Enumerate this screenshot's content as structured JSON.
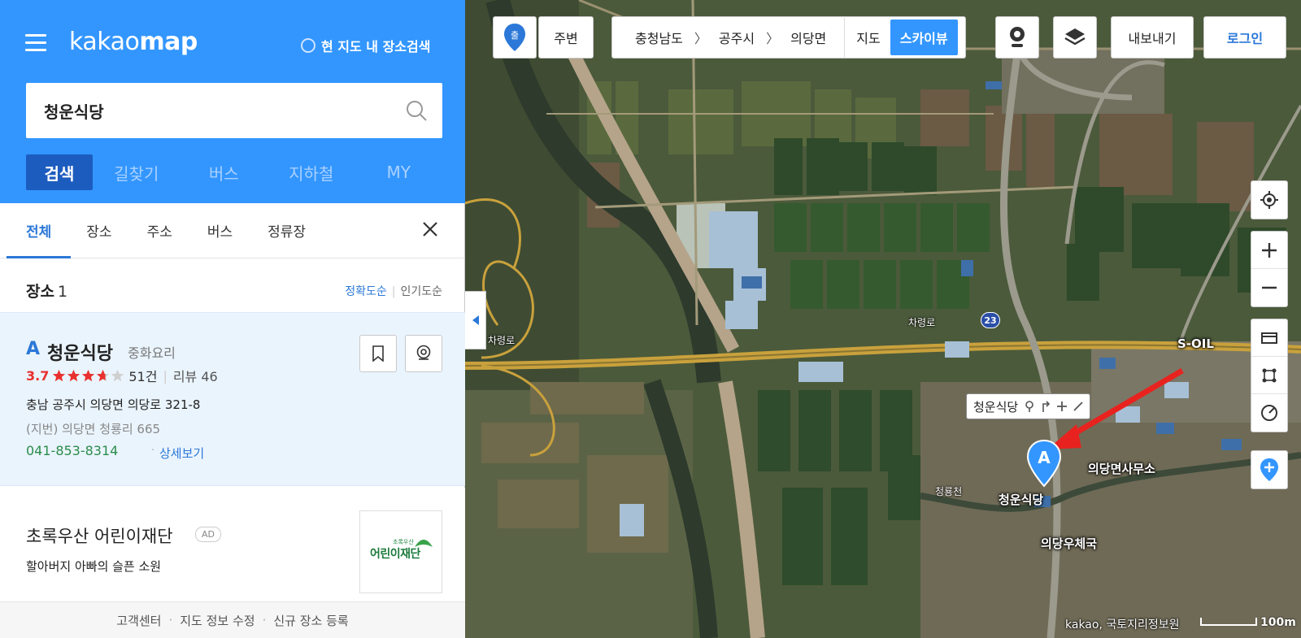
{
  "header": {
    "logo_left": "kakao",
    "logo_right": "map",
    "area_search": "현 지도 내 장소검색",
    "search_value": "청운식당",
    "tabs": [
      "검색",
      "길찾기",
      "버스",
      "지하철",
      "MY"
    ]
  },
  "subtabs": [
    "전체",
    "장소",
    "주소",
    "버스",
    "정류장"
  ],
  "results": {
    "title": "장소",
    "count": "1",
    "sort_accuracy": "정확도순",
    "sort_popular": "인기도순"
  },
  "place": {
    "marker": "A",
    "name": "청운식당",
    "category": "중화요리",
    "rating": "3.7",
    "rating_value": 3.7,
    "rating_count": "51건",
    "review": "리뷰 46",
    "address": "충남 공주시 의당면 의당로 321-8",
    "jibun": "(지번) 의당면 청룡리 665",
    "phone": "041-853-8314",
    "detail": "상세보기"
  },
  "ad": {
    "title": "초록우산 어린이재단",
    "badge": "AD",
    "desc": "할아버지 아빠의 슬픈 소원",
    "logo_small": "초록우산",
    "logo_big": "어린이재단"
  },
  "footer": [
    "고객센터",
    "지도 정보 수정",
    "신규 장소 등록"
  ],
  "toolbar": {
    "start": "출",
    "near": "주변",
    "crumbs": [
      "충청남도",
      "공주시",
      "의당면"
    ],
    "map": "지도",
    "skyview": "스카이뷰",
    "export": "내보내기",
    "login": "로그인"
  },
  "map_labels": {
    "road1": "차령로",
    "road2": "차령로",
    "route": "23",
    "soil": "S-OIL",
    "office": "의당면사무소",
    "stream": "청룡천",
    "place": "청운식당",
    "post": "의당우체국",
    "tooltip": "청운식당",
    "marker": "A",
    "copyright": "kakao, 국토지리정보원",
    "scale": "100m"
  },
  "colors": {
    "brand_blue": "#3396ff",
    "dark_blue": "#1d5cbf",
    "rating_red": "#e8312f",
    "phone_green": "#2a8c4a",
    "arrow_red": "#e8231f",
    "road_yellow": "#c9a13c"
  }
}
